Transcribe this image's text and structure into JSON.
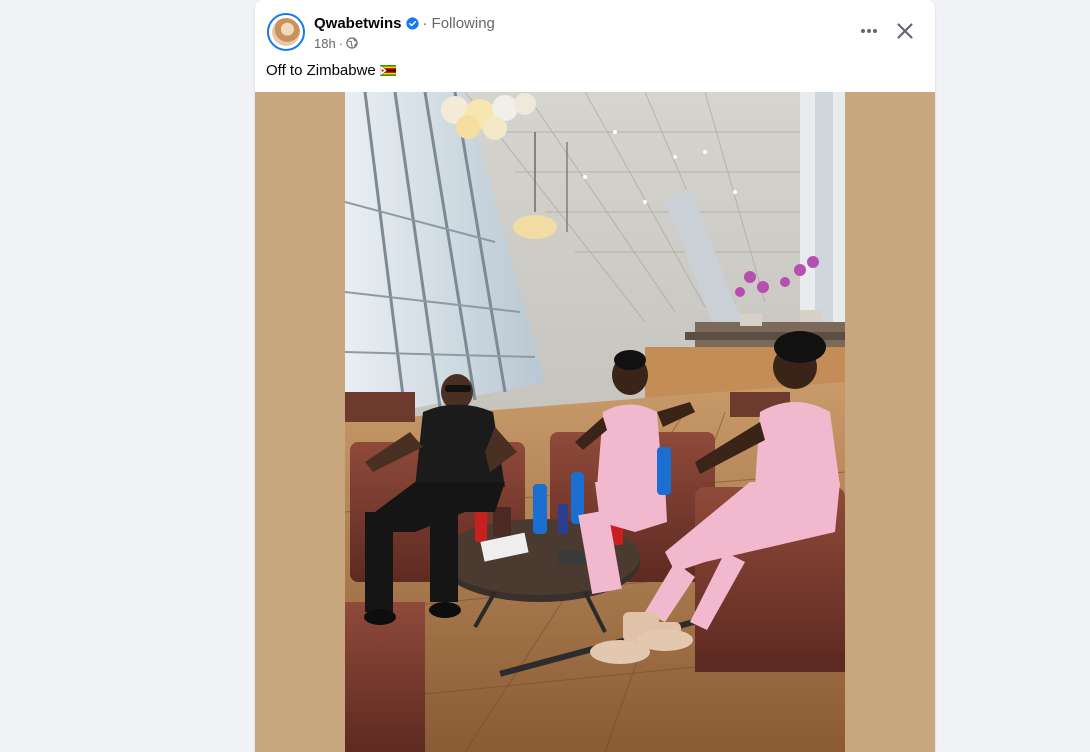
{
  "post": {
    "author": "Qwabetwins",
    "follow_status": "Following",
    "timestamp": "18h",
    "caption": "Off to Zimbabwe",
    "separator": "·"
  },
  "icons": {
    "avatar": "profile-photo",
    "verified": "verified-badge-icon",
    "privacy": "globe-icon",
    "more": "more-horizontal-icon",
    "close": "close-icon",
    "flag": "zimbabwe-flag-emoji"
  },
  "colors": {
    "brand_blue": "#1877f2",
    "secondary_text": "#65676b",
    "primary_text": "#050505",
    "media_background": "#c8a77e",
    "page_background": "#f0f2f5"
  }
}
